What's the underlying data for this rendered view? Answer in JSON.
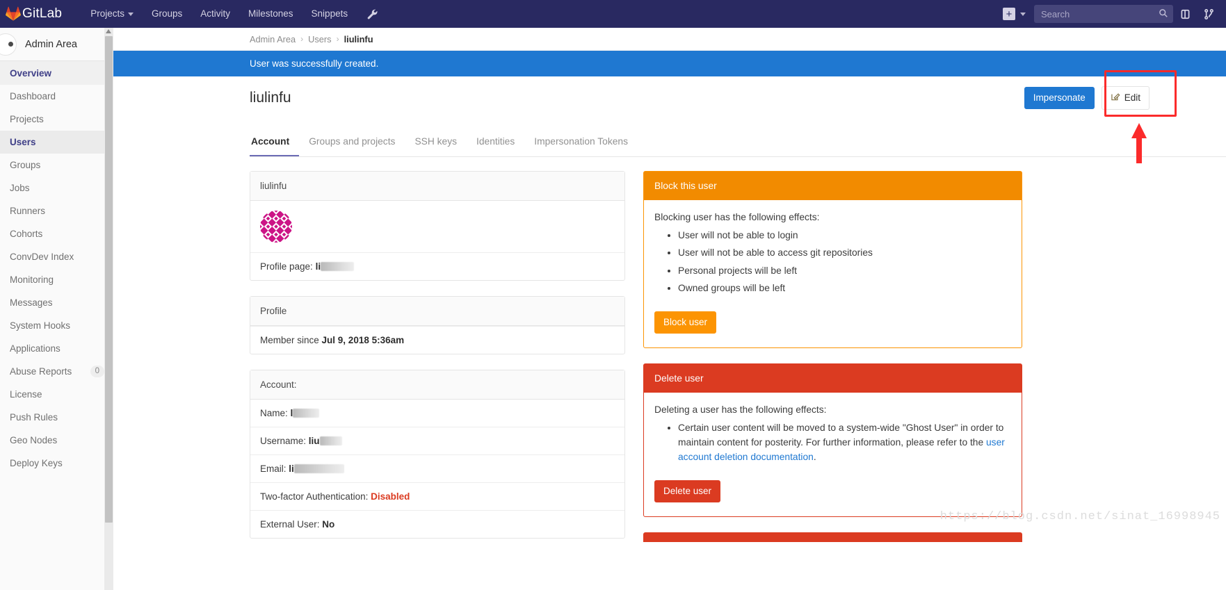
{
  "topnav": {
    "brand": "GitLab",
    "links": [
      {
        "label": "Projects",
        "has_caret": true
      },
      {
        "label": "Groups",
        "has_caret": false
      },
      {
        "label": "Activity",
        "has_caret": false
      },
      {
        "label": "Milestones",
        "has_caret": false
      },
      {
        "label": "Snippets",
        "has_caret": false
      }
    ],
    "wrench_icon": "wrench-icon",
    "new_icon": "plus-icon",
    "search_placeholder": "Search",
    "search_value": "",
    "icons": [
      "issues-icon",
      "merge-requests-icon"
    ]
  },
  "sidebar": {
    "title": "Admin Area",
    "items": [
      {
        "label": "Overview",
        "type": "group",
        "active": false
      },
      {
        "label": "Dashboard",
        "type": "item",
        "active": false
      },
      {
        "label": "Projects",
        "type": "item",
        "active": false
      },
      {
        "label": "Users",
        "type": "item",
        "active": true
      },
      {
        "label": "Groups",
        "type": "item",
        "active": false
      },
      {
        "label": "Jobs",
        "type": "item",
        "active": false
      },
      {
        "label": "Runners",
        "type": "item",
        "active": false
      },
      {
        "label": "Cohorts",
        "type": "item",
        "active": false
      },
      {
        "label": "ConvDev Index",
        "type": "item",
        "active": false
      },
      {
        "label": "Monitoring",
        "type": "item",
        "active": false
      },
      {
        "label": "Messages",
        "type": "item",
        "active": false
      },
      {
        "label": "System Hooks",
        "type": "item",
        "active": false
      },
      {
        "label": "Applications",
        "type": "item",
        "active": false
      },
      {
        "label": "Abuse Reports",
        "type": "item",
        "active": false,
        "badge": "0"
      },
      {
        "label": "License",
        "type": "item",
        "active": false
      },
      {
        "label": "Push Rules",
        "type": "item",
        "active": false
      },
      {
        "label": "Geo Nodes",
        "type": "item",
        "active": false
      },
      {
        "label": "Deploy Keys",
        "type": "item",
        "active": false
      }
    ]
  },
  "breadcrumb": {
    "root": "Admin Area",
    "section": "Users",
    "current": "liulinfu",
    "separator": "›"
  },
  "flash": {
    "message": "User was successfully created.",
    "color": "#1f78d1"
  },
  "page": {
    "title": "liulinfu",
    "impersonate_label": "Impersonate",
    "edit_label": "Edit",
    "edit_icon": "pencil-square-icon",
    "highlight_color": "#fb2b2b"
  },
  "tabs": [
    {
      "label": "Account",
      "active": true
    },
    {
      "label": "Groups and projects",
      "active": false
    },
    {
      "label": "SSH keys",
      "active": false
    },
    {
      "label": "Identities",
      "active": false
    },
    {
      "label": "Impersonation Tokens",
      "active": false
    }
  ],
  "user_card": {
    "header": "liulinfu",
    "avatar_icon": "identicon-avatar",
    "avatar_color": "#cc1486",
    "profile_page_label": "Profile page:",
    "profile_page_value_visible": "li",
    "profile_page_value_redacted": true
  },
  "profile_card": {
    "header": "Profile",
    "member_since_label": "Member since",
    "member_since_value": "Jul 9, 2018 5:36am"
  },
  "account_card": {
    "header": "Account:",
    "rows": [
      {
        "label": "Name:",
        "visible": "l",
        "redacted": true,
        "redact_width": 38
      },
      {
        "label": "Username:",
        "visible": "liu",
        "redacted": true,
        "redact_width": 32
      },
      {
        "label": "Email:",
        "visible": "li",
        "redacted": true,
        "redact_width": 72
      },
      {
        "label": "Two-factor Authentication:",
        "visible": "Disabled",
        "redacted": false,
        "danger": true
      },
      {
        "label": "External User:",
        "visible": "No",
        "redacted": false
      }
    ]
  },
  "block_panel": {
    "title": "Block this user",
    "intro": "Blocking user has the following effects:",
    "effects": [
      "User will not be able to login",
      "User will not be able to access git repositories",
      "Personal projects will be left",
      "Owned groups will be left"
    ],
    "button_label": "Block user",
    "color": "#f28b00"
  },
  "delete_panel": {
    "title": "Delete user",
    "intro": "Deleting a user has the following effects:",
    "effect_text_before": "Certain user content will be moved to a system-wide \"Ghost User\" in order to maintain content for posterity. For further information, please refer to the ",
    "effect_link": "user account deletion documentation",
    "effect_text_after": ".",
    "button_label": "Delete user",
    "color": "#db3b21"
  },
  "watermark": {
    "text": "https://blog.csdn.net/sinat_16998945"
  }
}
